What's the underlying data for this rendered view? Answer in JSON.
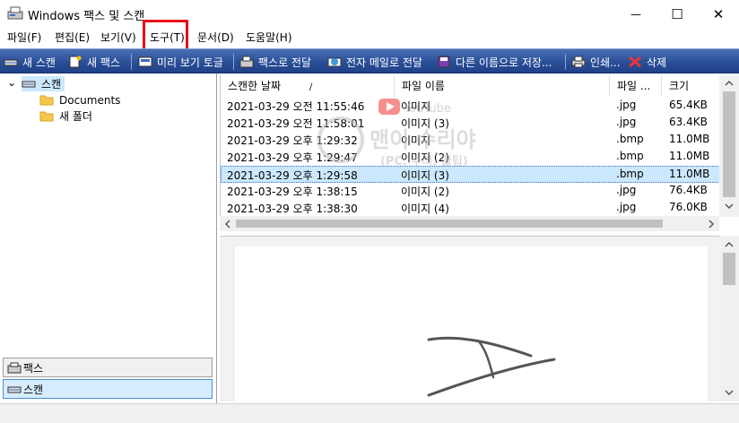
{
  "window": {
    "title": "Windows 팩스 및 스캔",
    "minimize_glyph": "—",
    "maximize_glyph": "☐",
    "close_glyph": "✕"
  },
  "menu": [
    "파일(F)",
    "편집(E)",
    "보기(V)",
    "도구(T)",
    "문서(D)",
    "도움말(H)"
  ],
  "toolbar": {
    "new_scan": "새 스캔",
    "new_fax": "새 팩스",
    "preview_toggle": "미리 보기 토글",
    "send_fax": "팩스로 전달",
    "send_email": "전자 메일로 전달",
    "save_as": "다른 이름으로 저장...",
    "print": "인쇄...",
    "delete": "삭제"
  },
  "tree": {
    "root": "스캔",
    "children": [
      "Documents",
      "새 폴더"
    ],
    "expand_glyph": "⌄"
  },
  "bottom_tabs": {
    "fax": "팩스",
    "scan": "스캔"
  },
  "list": {
    "columns": [
      "스캔한 날짜",
      "파일 이름",
      "파일 ...",
      "크기"
    ],
    "sort_indicator": "/",
    "rows": [
      {
        "date": "2021-03-29 오전 11:55:46",
        "name": "이미지",
        "type": ".jpg",
        "size": "65.4KB"
      },
      {
        "date": "2021-03-29 오전 11:58:01",
        "name": "이미지 (3)",
        "type": ".jpg",
        "size": "63.4KB"
      },
      {
        "date": "2021-03-29 오후 1:29:32",
        "name": "이미지",
        "type": ".bmp",
        "size": "11.0MB"
      },
      {
        "date": "2021-03-29 오후 1:29:47",
        "name": "이미지 (2)",
        "type": ".bmp",
        "size": "11.0MB"
      },
      {
        "date": "2021-03-29 오후 1:29:58",
        "name": "이미지 (3)",
        "type": ".bmp",
        "size": "11.0MB"
      },
      {
        "date": "2021-03-29 오후 1:38:15",
        "name": "이미지 (2)",
        "type": ".jpg",
        "size": "76.4KB"
      },
      {
        "date": "2021-03-29 오후 1:38:30",
        "name": "이미지 (4)",
        "type": ".jpg",
        "size": "76.0KB"
      }
    ],
    "selected_index": 4
  },
  "watermark": {
    "line1": "맨이 수리야",
    "line2": "(PC, 수리, 꿀팁)",
    "tube_word": "YouTube"
  },
  "colors": {
    "toolbar": "#2a4f97",
    "selection": "#cce8ff",
    "highlight": "#e8101a"
  }
}
